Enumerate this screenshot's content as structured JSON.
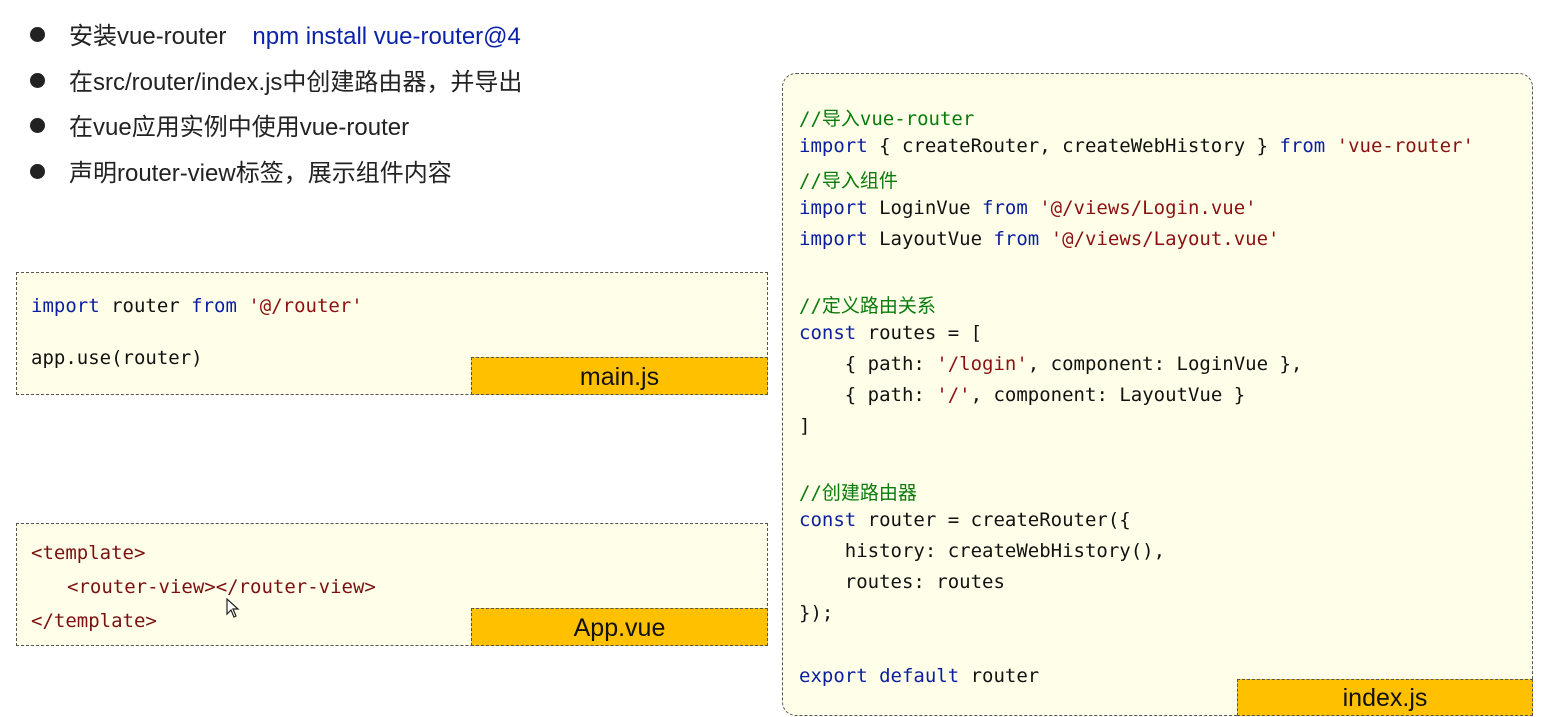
{
  "bullets": [
    {
      "text": "安装vue-router",
      "command": "npm install vue-router@4"
    },
    {
      "text": "在src/router/index.js中创建路由器，并导出"
    },
    {
      "text": "在vue应用实例中使用vue-router"
    },
    {
      "text": "声明router-view标签，展示组件内容"
    }
  ],
  "main_js": {
    "label": "main.js",
    "import_kw": "import",
    "import_name": " router ",
    "from_kw": "from",
    "import_path": " '@/router'",
    "use_line": "app.use(router)"
  },
  "app_vue": {
    "label": "App.vue",
    "open_tag": "<template>",
    "inner_tag": "<router-view></router-view>",
    "close_tag": "</template>"
  },
  "index_js": {
    "label": "index.js",
    "c_import_router": "//导入vue-router",
    "l1_kw": "import",
    "l1_body": " { createRouter, createWebHistory } ",
    "l1_from": "from",
    "l1_str": " 'vue-router'",
    "c_import_comp": "//导入组件",
    "l2_kw": "import",
    "l2_body": " LoginVue ",
    "l2_from": "from",
    "l2_str": " '@/views/Login.vue'",
    "l3_kw": "import",
    "l3_body": " LayoutVue ",
    "l3_from": "from",
    "l3_str": " '@/views/Layout.vue'",
    "c_routes": "//定义路由关系",
    "l4_kw": "const",
    "l4_body": " routes = [",
    "l5_a": "    { path: ",
    "l5_str": "'/login'",
    "l5_b": ", component: LoginVue },",
    "l6_a": "    { path: ",
    "l6_str": "'/'",
    "l6_b": ", component: LayoutVue }",
    "l7": "]",
    "c_create": "//创建路由器",
    "l8_kw": "const",
    "l8_body": " router = createRouter({",
    "l9": "    history: createWebHistory(),",
    "l10": "    routes: routes",
    "l11": "});",
    "l12_kw1": "export",
    "l12_kw2": " default",
    "l12_body": " router"
  }
}
